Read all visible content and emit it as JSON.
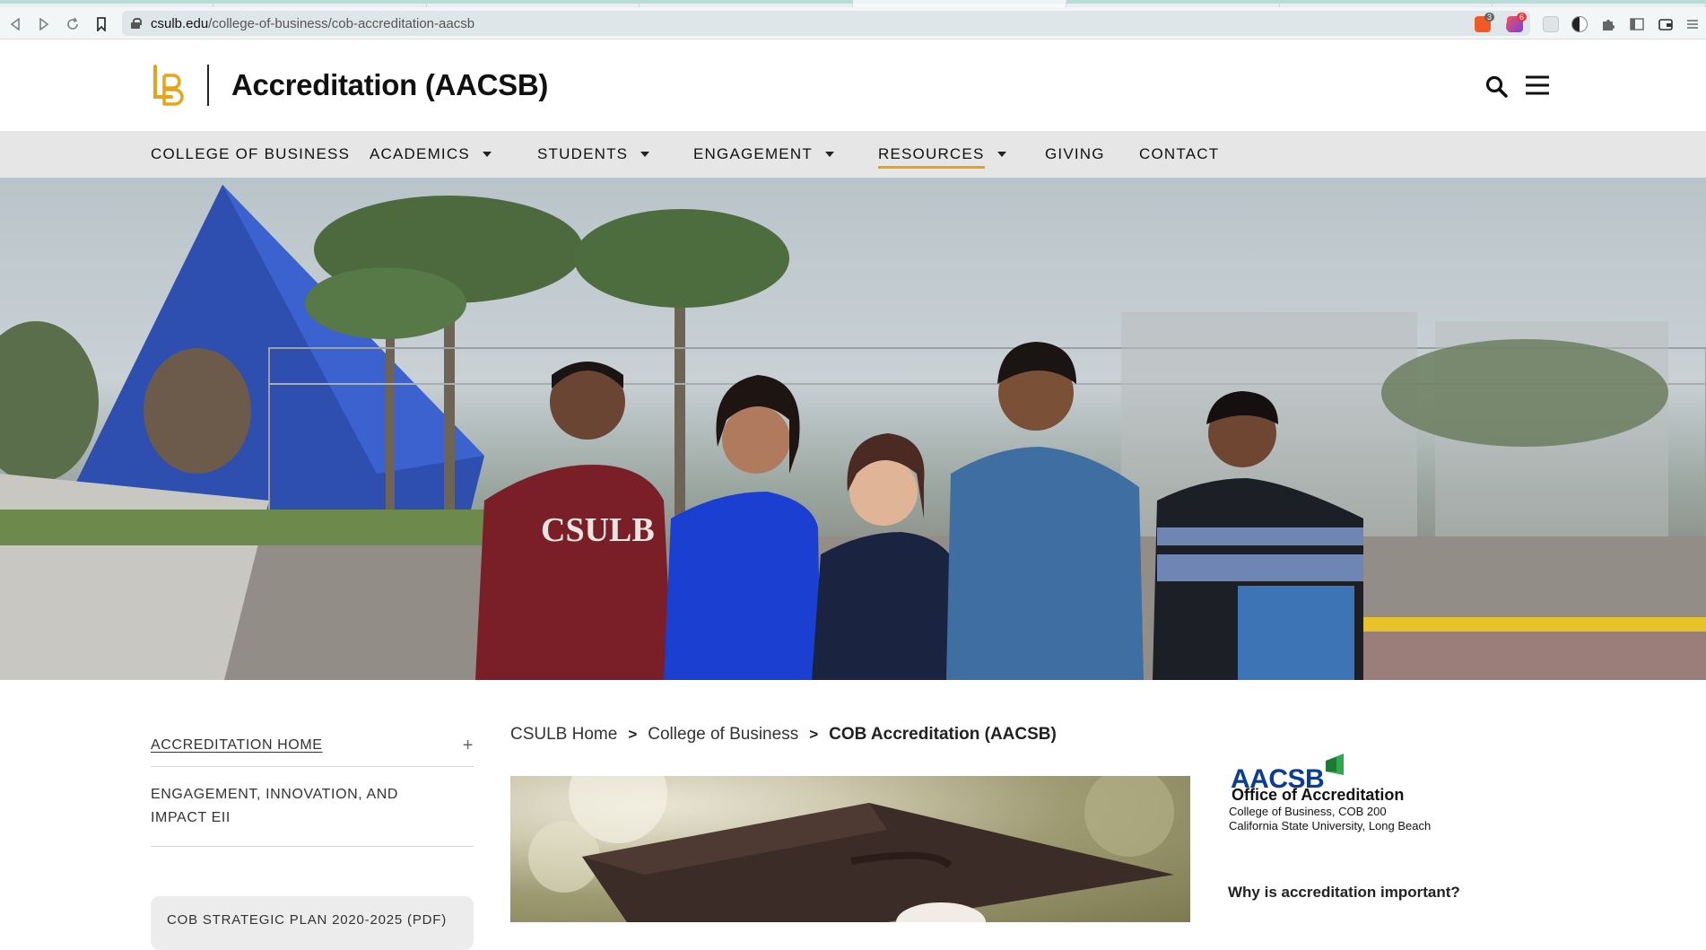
{
  "browser": {
    "url_host": "csulb.edu",
    "url_path": "/college-of-business/cob-accreditation-aacsb",
    "extension_badges": [
      "3",
      "6"
    ]
  },
  "header": {
    "title": "Accreditation (AACSB)"
  },
  "nav": {
    "items": [
      {
        "label": "COLLEGE OF BUSINESS",
        "dropdown": false
      },
      {
        "label": "ACADEMICS",
        "dropdown": true
      },
      {
        "label": "STUDENTS",
        "dropdown": true
      },
      {
        "label": "ENGAGEMENT",
        "dropdown": true
      },
      {
        "label": "RESOURCES",
        "dropdown": true,
        "active": true
      },
      {
        "label": "GIVING",
        "dropdown": false
      },
      {
        "label": "CONTACT",
        "dropdown": false
      }
    ]
  },
  "hero": {
    "hoodie_text": "CSULB"
  },
  "sidebar": {
    "items": [
      {
        "label": "ACCREDITATION HOME",
        "expand": "+"
      },
      {
        "label": "ENGAGEMENT, INNOVATION, AND IMPACT EII"
      }
    ],
    "card_label": "COB STRATEGIC PLAN 2020-2025 (PDF)"
  },
  "breadcrumb": {
    "items": [
      "CSULB Home",
      "College of Business",
      "COB Accreditation (AACSB)"
    ],
    "separator": ">"
  },
  "aacsb": {
    "logo_text": "AACSB",
    "office": "Office of Accreditation",
    "line1": "College of Business, COB 200",
    "line2": "California State University, Long Beach",
    "question": "Why is accreditation important?"
  },
  "colors": {
    "accent_gold": "#e8a317",
    "nav_bg": "#e6e6e6",
    "aacsb_blue": "#0b3d91",
    "aacsb_green": "#2ea84a"
  }
}
